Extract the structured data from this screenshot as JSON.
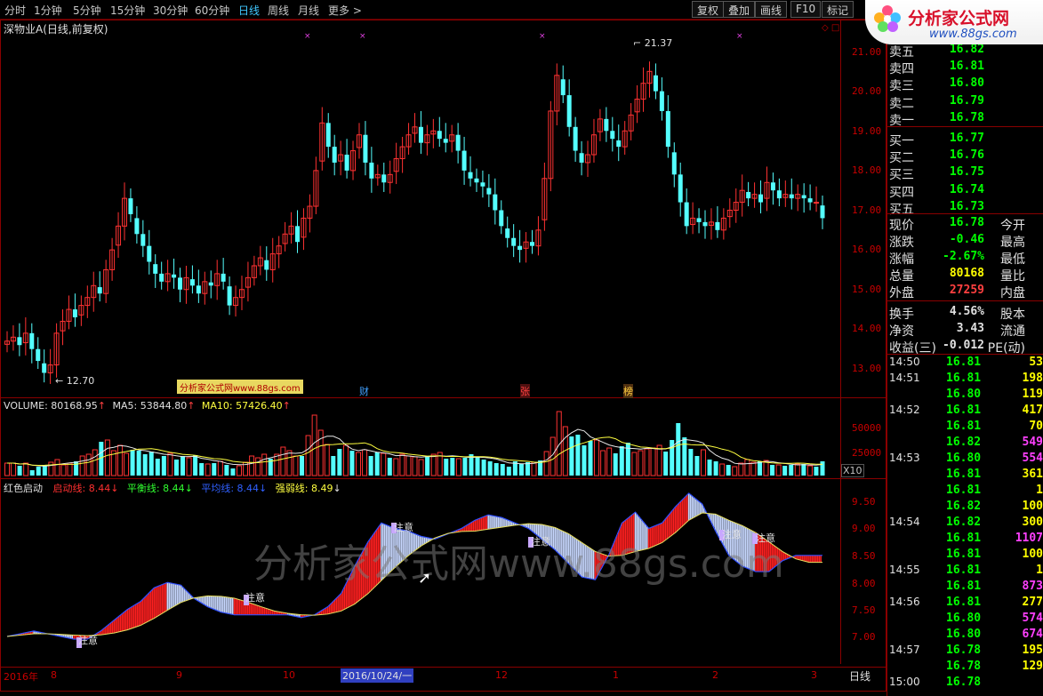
{
  "toolbar": {
    "periods": [
      "分时",
      "1分钟",
      "5分钟",
      "15分钟",
      "30分钟",
      "60分钟",
      "日线",
      "周线",
      "月线",
      "更多 >"
    ],
    "active_period": "日线",
    "buttons": [
      "复权",
      "叠加",
      "画线",
      "F10",
      "标记"
    ]
  },
  "logo": {
    "title": "分析家公式网",
    "url": "www.88gs.com"
  },
  "stock": {
    "title": "深物业A(日线,前复权)"
  },
  "price_axis": {
    "labels": [
      "21.00",
      "20.00",
      "19.00",
      "18.00",
      "17.00",
      "16.00",
      "15.00",
      "14.00",
      "13.00"
    ]
  },
  "annotations": {
    "high": "21.37",
    "low": "12.70",
    "ad_box": "分析家公式网www.88gs.com",
    "events": [
      "财",
      "张",
      "榜"
    ]
  },
  "volume": {
    "label": "VOLUME: 80168.95",
    "ma5": "MA5: 53844.80",
    "ma10": "MA10: 57426.40",
    "axis": [
      "50000",
      "25000"
    ],
    "unit": "X10"
  },
  "indicator": {
    "name": "红色启动",
    "launch": "启动线: 8.44",
    "balance": "平衡线: 8.44",
    "average": "平均线: 8.44",
    "strength": "强弱线: 8.49",
    "axis": [
      "9.50",
      "9.00",
      "8.50",
      "8.00",
      "7.50",
      "7.00"
    ],
    "attention_label": "注意"
  },
  "date_axis": [
    "2016年",
    "8",
    "9",
    "10",
    "12",
    "1",
    "2",
    "3"
  ],
  "cursor_date": "2016/10/24/一",
  "period_tab": "日线",
  "order_book": [
    {
      "label": "卖五",
      "price": "16.82"
    },
    {
      "label": "卖四",
      "price": "16.81"
    },
    {
      "label": "卖三",
      "price": "16.80"
    },
    {
      "label": "卖二",
      "price": "16.79"
    },
    {
      "label": "卖一",
      "price": "16.78"
    },
    {
      "label": "买一",
      "price": "16.77"
    },
    {
      "label": "买二",
      "price": "16.76"
    },
    {
      "label": "买三",
      "price": "16.75"
    },
    {
      "label": "买四",
      "price": "16.74"
    },
    {
      "label": "买五",
      "price": "16.73"
    }
  ],
  "quote": [
    {
      "label": "现价",
      "value": "16.78",
      "label2": "今开",
      "color": "#00ff00"
    },
    {
      "label": "涨跌",
      "value": "-0.46",
      "label2": "最高",
      "color": "#00ff00"
    },
    {
      "label": "涨幅",
      "value": "-2.67%",
      "label2": "最低",
      "color": "#00ff00"
    },
    {
      "label": "总量",
      "value": "80168",
      "label2": "量比",
      "color": "#ffff00"
    },
    {
      "label": "外盘",
      "value": "27259",
      "label2": "内盘",
      "color": "#ff4040"
    },
    {
      "label": "换手",
      "value": "4.56%",
      "label2": "股本",
      "color": "#e0e0e0"
    },
    {
      "label": "净资",
      "value": "3.43",
      "label2": "流通",
      "color": "#e0e0e0"
    },
    {
      "label": "收益(三)",
      "value": "-0.012",
      "label2": "PE(动)",
      "color": "#e0e0e0"
    }
  ],
  "ticks": [
    {
      "time": "14:50",
      "price": "16.81",
      "vol": "53",
      "pc": "#00ff00",
      "vc": "#ffff00"
    },
    {
      "time": "14:51",
      "price": "16.81",
      "vol": "198",
      "pc": "#00ff00",
      "vc": "#ffff00"
    },
    {
      "time": "",
      "price": "16.80",
      "vol": "119",
      "pc": "#00ff00",
      "vc": "#ffff00"
    },
    {
      "time": "14:52",
      "price": "16.81",
      "vol": "417",
      "pc": "#00ff00",
      "vc": "#ffff00"
    },
    {
      "time": "",
      "price": "16.81",
      "vol": "70",
      "pc": "#00ff00",
      "vc": "#ffff00"
    },
    {
      "time": "",
      "price": "16.82",
      "vol": "549",
      "pc": "#00ff00",
      "vc": "#ff40ff"
    },
    {
      "time": "14:53",
      "price": "16.80",
      "vol": "554",
      "pc": "#00ff00",
      "vc": "#ff40ff"
    },
    {
      "time": "",
      "price": "16.81",
      "vol": "361",
      "pc": "#00ff00",
      "vc": "#ffff00"
    },
    {
      "time": "",
      "price": "16.81",
      "vol": "1",
      "pc": "#00ff00",
      "vc": "#ffff00"
    },
    {
      "time": "",
      "price": "16.82",
      "vol": "100",
      "pc": "#00ff00",
      "vc": "#ffff00"
    },
    {
      "time": "14:54",
      "price": "16.82",
      "vol": "300",
      "pc": "#00ff00",
      "vc": "#ffff00"
    },
    {
      "time": "",
      "price": "16.81",
      "vol": "1107",
      "pc": "#00ff00",
      "vc": "#ff40ff"
    },
    {
      "time": "",
      "price": "16.81",
      "vol": "100",
      "pc": "#00ff00",
      "vc": "#ffff00"
    },
    {
      "time": "14:55",
      "price": "16.81",
      "vol": "1",
      "pc": "#00ff00",
      "vc": "#ffff00"
    },
    {
      "time": "",
      "price": "16.81",
      "vol": "873",
      "pc": "#00ff00",
      "vc": "#ff40ff"
    },
    {
      "time": "14:56",
      "price": "16.81",
      "vol": "277",
      "pc": "#00ff00",
      "vc": "#ffff00"
    },
    {
      "time": "",
      "price": "16.80",
      "vol": "574",
      "pc": "#00ff00",
      "vc": "#ff40ff"
    },
    {
      "time": "",
      "price": "16.80",
      "vol": "674",
      "pc": "#00ff00",
      "vc": "#ff40ff"
    },
    {
      "time": "14:57",
      "price": "16.78",
      "vol": "195",
      "pc": "#00ff00",
      "vc": "#ffff00"
    },
    {
      "time": "",
      "price": "16.78",
      "vol": "129",
      "pc": "#00ff00",
      "vc": "#ffff00"
    },
    {
      "time": "15:00",
      "price": "16.78",
      "vol": "",
      "pc": "#00ff00",
      "vc": "#ffff00"
    }
  ],
  "watermark": "分析家公式网www.88gs.com",
  "chart_data": [
    {
      "type": "candlestick",
      "title": "深物业A(日线,前复权)",
      "ylim": [
        12.5,
        21.5
      ],
      "closes": [
        13.7,
        13.8,
        13.6,
        13.9,
        13.5,
        13.2,
        12.9,
        13.1,
        13.9,
        14.2,
        14.5,
        14.3,
        14.6,
        14.8,
        15.1,
        14.9,
        15.5,
        16.0,
        16.6,
        17.3,
        16.9,
        16.4,
        16.1,
        15.7,
        15.4,
        15.2,
        15.4,
        15.3,
        15.0,
        15.3,
        15.1,
        14.9,
        15.2,
        15.1,
        15.4,
        15.2,
        14.6,
        14.8,
        15.0,
        15.3,
        15.6,
        15.8,
        15.5,
        15.9,
        16.1,
        16.4,
        16.6,
        16.2,
        16.8,
        17.1,
        18.0,
        19.2,
        18.6,
        18.2,
        18.4,
        18.0,
        18.5,
        18.9,
        18.2,
        17.8,
        17.9,
        17.7,
        17.9,
        18.3,
        18.6,
        18.9,
        19.1,
        18.7,
        18.9,
        19.0,
        18.8,
        18.7,
        18.9,
        18.5,
        18.0,
        17.8,
        17.7,
        17.6,
        17.4,
        17.0,
        16.6,
        16.3,
        16.1,
        16.0,
        16.2,
        16.1,
        16.5,
        17.8,
        19.5,
        20.4,
        19.9,
        19.1,
        18.5,
        18.2,
        18.4,
        18.9,
        19.3,
        19.0,
        18.8,
        18.6,
        19.0,
        19.4,
        19.8,
        20.2,
        20.5,
        20.0,
        19.5,
        18.6,
        17.9,
        17.2,
        16.6,
        16.8,
        16.7,
        16.6,
        16.7,
        16.5,
        16.8,
        17.0,
        17.2,
        17.5,
        17.3,
        17.4,
        17.2,
        17.7,
        17.5,
        17.3,
        17.4,
        17.3,
        17.4,
        17.3,
        17.2,
        17.2,
        16.8
      ],
      "annotations": [
        "21.37",
        "12.70"
      ]
    },
    {
      "type": "bar",
      "title": "VOLUME",
      "series": [
        {
          "name": "VOLUME",
          "values": [
            14000,
            14000,
            11000,
            14000,
            6000,
            10000,
            12000,
            15000,
            18000,
            12000,
            14000,
            16000,
            22000,
            24000,
            29000,
            38000,
            40000,
            28000,
            34000,
            25000,
            29000,
            28000,
            24000,
            27000,
            19000,
            22000,
            25000,
            18000,
            22000,
            20000,
            23000,
            14000,
            13000,
            14000,
            16000,
            12000,
            8000,
            11000,
            15000,
            22000,
            20000,
            24000,
            19000,
            24000,
            32000,
            28000,
            22000,
            22000,
            45000,
            68000,
            51000,
            35000,
            22000,
            30000,
            34000,
            28000,
            26000,
            29000,
            22000,
            26000,
            25000,
            20000,
            19000,
            24000,
            22000,
            21000,
            18000,
            22000,
            24000,
            26000,
            19000,
            20000,
            19000,
            20000,
            24000,
            21000,
            18000,
            16000,
            14000,
            13000,
            10000,
            16000,
            13000,
            15000,
            15000,
            17000,
            27000,
            43000,
            72000,
            55000,
            44000,
            46000,
            34000,
            39000,
            40000,
            28000,
            31000,
            25000,
            33000,
            37000,
            26000,
            28000,
            30000,
            31000,
            34000,
            27000,
            40000,
            59000,
            43000,
            30000,
            22000,
            29000,
            18000,
            16000,
            13000,
            12000,
            10000,
            14000,
            18000,
            15000,
            16000,
            17000,
            12000,
            12000,
            11000,
            12000,
            13000,
            13000,
            11000,
            10000,
            16000
          ]
        },
        {
          "name": "MA5",
          "values": []
        },
        {
          "name": "MA10",
          "values": []
        }
      ],
      "ylim": [
        0,
        75000
      ]
    },
    {
      "type": "area",
      "title": "红色启动",
      "series": [
        {
          "name": "启动线",
          "values": [
            7.0,
            7.05,
            7.1,
            7.05,
            7.0,
            6.95,
            6.95,
            7.1,
            7.3,
            7.5,
            7.65,
            7.9,
            8.0,
            7.95,
            7.7,
            7.55,
            7.45,
            7.4,
            7.4,
            7.4,
            7.4,
            7.4,
            7.35,
            7.4,
            7.55,
            7.8,
            8.3,
            8.75,
            9.1,
            9.0,
            8.95,
            8.85,
            8.8,
            8.9,
            9.0,
            9.15,
            9.25,
            9.2,
            9.1,
            9.0,
            8.8,
            8.6,
            8.35,
            8.1,
            8.05,
            8.5,
            9.1,
            9.3,
            9.0,
            9.1,
            9.4,
            9.65,
            9.45,
            8.95,
            8.5,
            8.3,
            8.2,
            8.2,
            8.4,
            8.5,
            8.5,
            8.5
          ]
        },
        {
          "name": "平衡线",
          "values": []
        },
        {
          "name": "平均线",
          "values": []
        },
        {
          "name": "强弱线",
          "values": []
        }
      ],
      "ylim": [
        6.6,
        9.9
      ]
    }
  ]
}
